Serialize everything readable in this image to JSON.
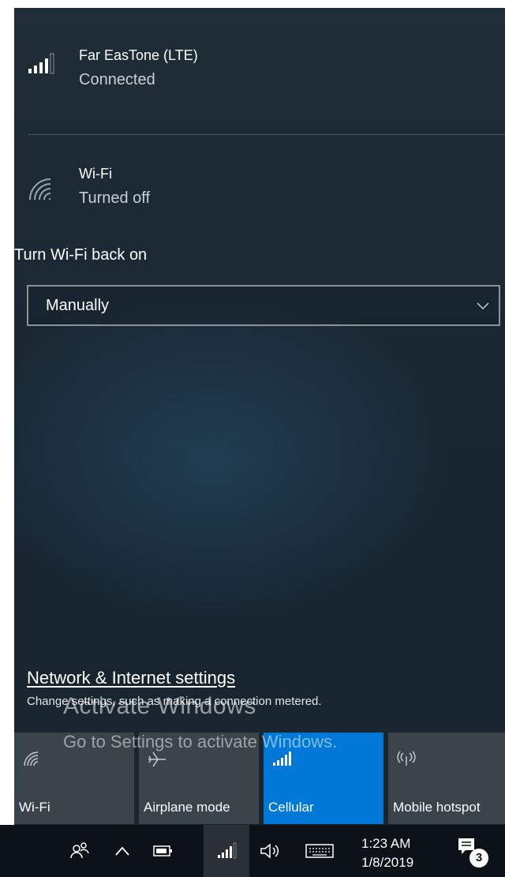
{
  "networks": [
    {
      "name": "Far EasTone (LTE)",
      "status": "Connected",
      "icon": "cellular-signal-icon"
    },
    {
      "name": "Wi-Fi",
      "status": "Turned off",
      "icon": "wifi-icon"
    }
  ],
  "wifi_back_on": {
    "label": "Turn Wi-Fi back on",
    "selected": "Manually"
  },
  "settings": {
    "link": "Network & Internet settings",
    "description": "Change settings, such as making a connection metered."
  },
  "watermark": {
    "title": "Activate Windows",
    "subtitle": "Go to Settings to activate Windows."
  },
  "tiles": [
    {
      "label": "Wi-Fi",
      "icon": "wifi-icon",
      "active": false
    },
    {
      "label": "Airplane mode",
      "icon": "airplane-icon",
      "active": false
    },
    {
      "label": "Cellular",
      "icon": "cellular-signal-icon",
      "active": true
    },
    {
      "label": "Mobile hotspot",
      "icon": "hotspot-icon",
      "active": false
    }
  ],
  "colors": {
    "accent": "#0078d7",
    "tile": "#3b444b",
    "taskbar": "#0c1217"
  },
  "taskbar": {
    "time": "1:23 AM",
    "date": "1/8/2019",
    "notification_count": "3"
  }
}
